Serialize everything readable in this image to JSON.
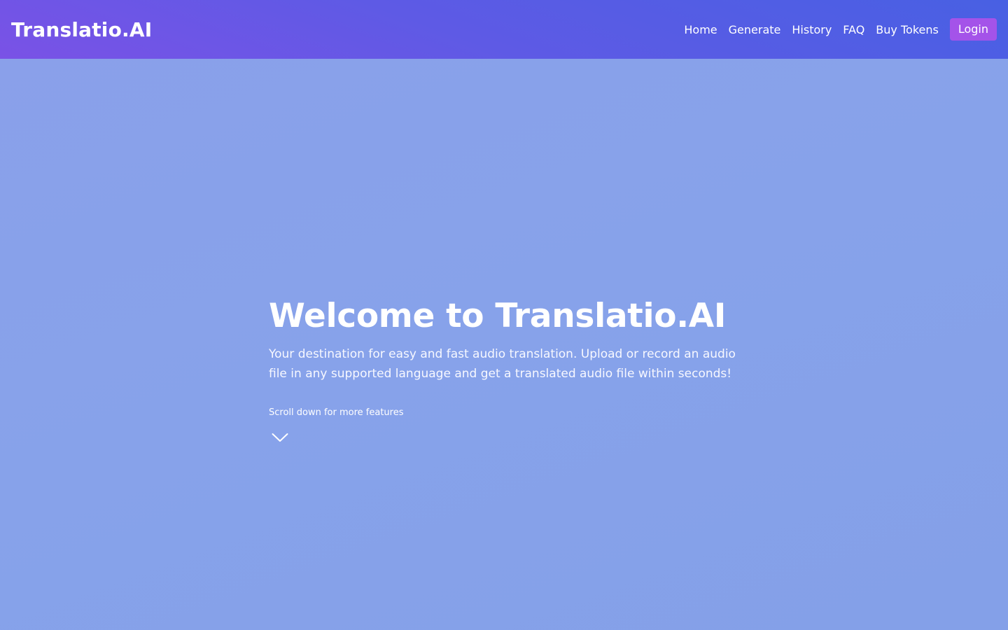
{
  "header": {
    "brand": "Translatio.AI",
    "nav": [
      {
        "label": "Home"
      },
      {
        "label": "Generate"
      },
      {
        "label": "History"
      },
      {
        "label": "FAQ"
      },
      {
        "label": "Buy Tokens"
      }
    ],
    "login_label": "Login"
  },
  "hero": {
    "title": "Welcome to Translatio.AI",
    "description": "Your destination for easy and fast audio translation. Upload or record an audio file in any supported language and get a translated audio file within seconds!",
    "scroll_hint": "Scroll down for more features",
    "scroll_icon": "chevron-down-icon"
  },
  "colors": {
    "navbar_start": "#7a52e6",
    "navbar_end": "#4860e3",
    "background": "#88a2ea",
    "login_button": "#a453e9",
    "text": "#ffffff"
  }
}
